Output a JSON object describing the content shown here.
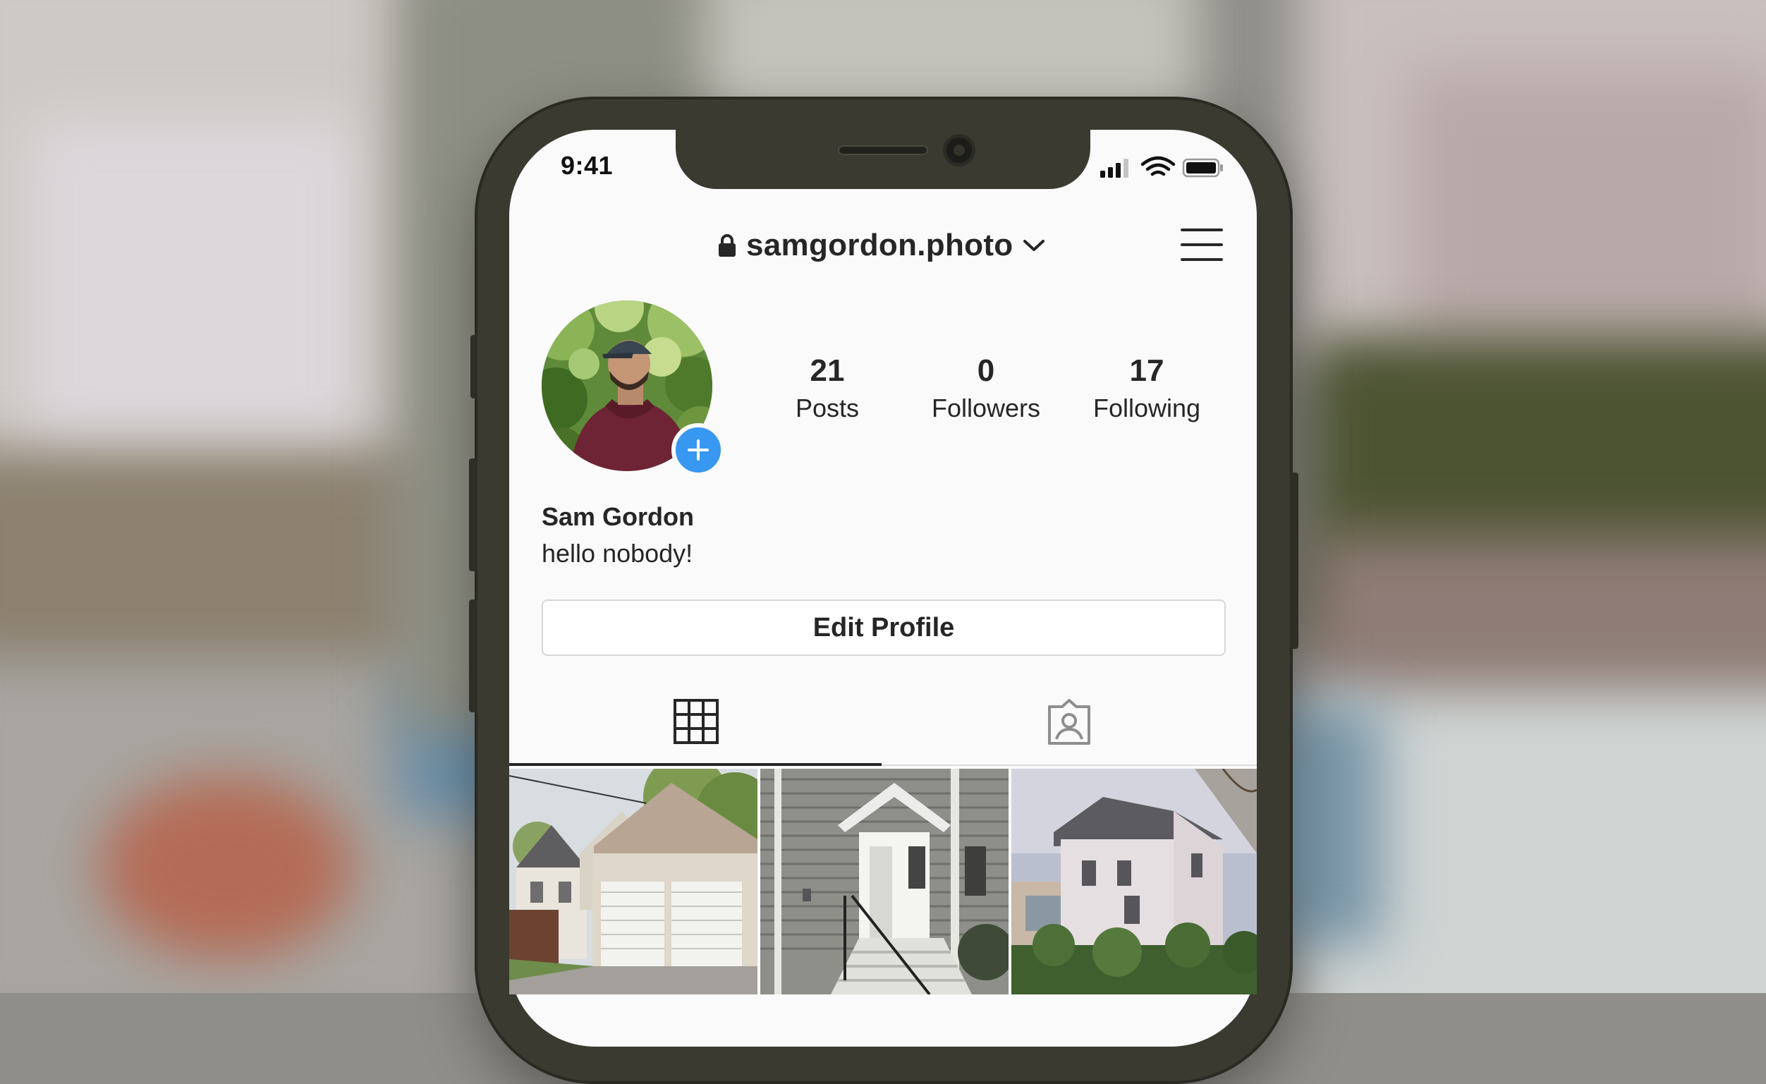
{
  "status_bar": {
    "time": "9:41"
  },
  "header": {
    "username": "samgordon.photo"
  },
  "profile": {
    "full_name": "Sam Gordon",
    "bio": "hello nobody!",
    "stats": [
      {
        "count": "21",
        "label": "Posts"
      },
      {
        "count": "0",
        "label": "Followers"
      },
      {
        "count": "17",
        "label": "Following"
      }
    ],
    "edit_profile_label": "Edit Profile"
  },
  "tabs": {
    "active": "grid"
  },
  "colors": {
    "accent_blue": "#3897f0",
    "text": "#262626",
    "phone_frame": "#3a3a30",
    "screen_bg": "#fafafa"
  },
  "icons": [
    "lock-icon",
    "chevron-down-icon",
    "hamburger-menu-icon",
    "plus-icon",
    "grid-icon",
    "tagged-person-icon",
    "signal-icon",
    "wifi-icon",
    "battery-icon"
  ]
}
